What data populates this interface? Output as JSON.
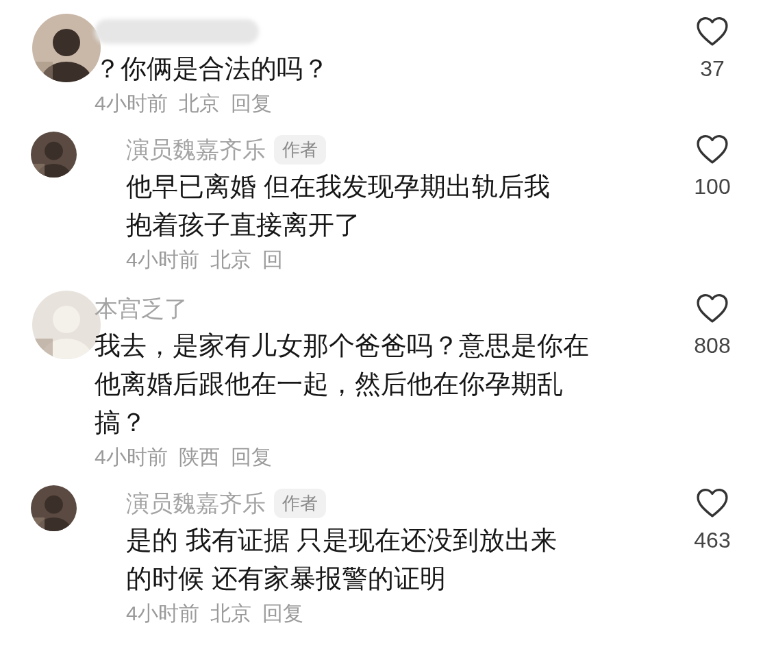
{
  "comments": [
    {
      "name_blurred": true,
      "text": "？你俩是合法的吗？",
      "time": "4小时前",
      "location": "北京",
      "reply": "回复",
      "likes": "37",
      "liked": false,
      "replies": [
        {
          "username": "演员魏嘉齐乐",
          "badge": "作者",
          "text": "他早已离婚 但在我发现孕期出轨后我抱着孩子直接离开了",
          "time": "4小时前",
          "location": "北京",
          "reply": "回",
          "likes": "100",
          "liked": false
        }
      ]
    },
    {
      "name_blurred": false,
      "username": "本宫乏了",
      "text": "我去，是家有儿女那个爸爸吗？意思是你在他离婚后跟他在一起，然后他在你孕期乱搞？",
      "time": "4小时前",
      "location": "陕西",
      "reply": "回复",
      "likes": "808",
      "liked": false,
      "replies": [
        {
          "username": "演员魏嘉齐乐",
          "badge": "作者",
          "text": "是的 我有证据 只是现在还没到放出来的时候 还有家暴报警的证明",
          "time": "4小时前",
          "location": "北京",
          "reply": "回复",
          "likes": "463",
          "liked": false
        }
      ]
    }
  ]
}
